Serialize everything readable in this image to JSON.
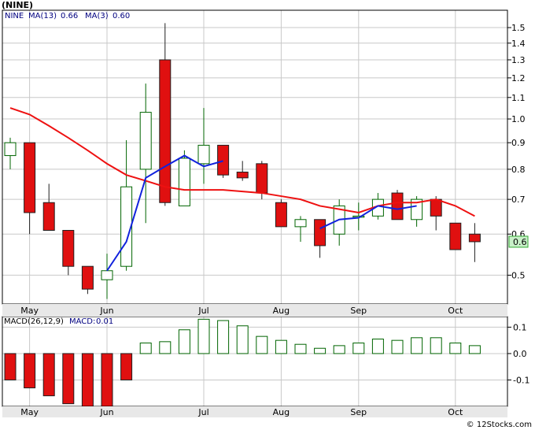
{
  "header": {
    "title": "(NINE)",
    "ma_legend": [
      {
        "label": "MA(13)",
        "value": "0.66",
        "color": "#000080"
      },
      {
        "label": "MA(3)",
        "value": "0.60",
        "color": "#000080"
      }
    ],
    "macd_legend": [
      {
        "label": "MACD(26,12,9)",
        "color": "#000000"
      },
      {
        "label": "MACD:",
        "value": "0.01",
        "color": "#000080"
      }
    ]
  },
  "colors": {
    "up_candle": "#ffffff",
    "up_outline": "#006400",
    "down_candle": "#e01010",
    "ma_long": "#ee1111",
    "ma_short": "#1122dd",
    "price_box": "#c8f0c8",
    "grid": "#c8c8c8"
  },
  "footer": {
    "copyright": "© 12Stocks.com"
  },
  "chart_data": [
    {
      "type": "candlestick",
      "scale": "log",
      "y_ticks": [
        "1.5",
        "1.4",
        "1.3",
        "1.2",
        "1.1",
        "1.0",
        "0.9",
        "0.8",
        "0.7",
        "0.6",
        "0.5"
      ],
      "y_tick_values": [
        1.5,
        1.4,
        1.3,
        1.2,
        1.1,
        1.0,
        0.9,
        0.8,
        0.7,
        0.6,
        0.5
      ],
      "ylim": [
        0.44,
        1.62
      ],
      "x_labels": [
        {
          "label": "May",
          "index": 1
        },
        {
          "label": "Jun",
          "index": 5
        },
        {
          "label": "Jul",
          "index": 10
        },
        {
          "label": "Aug",
          "index": 14
        },
        {
          "label": "Sep",
          "index": 18
        },
        {
          "label": "Oct",
          "index": 23
        }
      ],
      "last_price": "0.6",
      "candles": [
        {
          "o": 0.85,
          "h": 0.92,
          "l": 0.8,
          "c": 0.9
        },
        {
          "o": 0.9,
          "h": 0.9,
          "l": 0.6,
          "c": 0.66
        },
        {
          "o": 0.69,
          "h": 0.75,
          "l": 0.61,
          "c": 0.61
        },
        {
          "o": 0.61,
          "h": 0.61,
          "l": 0.5,
          "c": 0.52
        },
        {
          "o": 0.52,
          "h": 0.52,
          "l": 0.46,
          "c": 0.47
        },
        {
          "o": 0.49,
          "h": 0.55,
          "l": 0.45,
          "c": 0.51
        },
        {
          "o": 0.52,
          "h": 0.91,
          "l": 0.51,
          "c": 0.74
        },
        {
          "o": 0.8,
          "h": 1.17,
          "l": 0.63,
          "c": 1.03
        },
        {
          "o": 1.3,
          "h": 1.53,
          "l": 0.68,
          "c": 0.69
        },
        {
          "o": 0.68,
          "h": 0.87,
          "l": 0.68,
          "c": 0.84
        },
        {
          "o": 0.82,
          "h": 1.05,
          "l": 0.75,
          "c": 0.89
        },
        {
          "o": 0.89,
          "h": 0.89,
          "l": 0.77,
          "c": 0.78
        },
        {
          "o": 0.79,
          "h": 0.83,
          "l": 0.76,
          "c": 0.77
        },
        {
          "o": 0.82,
          "h": 0.83,
          "l": 0.7,
          "c": 0.72
        },
        {
          "o": 0.69,
          "h": 0.7,
          "l": 0.62,
          "c": 0.62
        },
        {
          "o": 0.62,
          "h": 0.65,
          "l": 0.58,
          "c": 0.64
        },
        {
          "o": 0.64,
          "h": 0.64,
          "l": 0.54,
          "c": 0.57
        },
        {
          "o": 0.6,
          "h": 0.7,
          "l": 0.57,
          "c": 0.68
        },
        {
          "o": 0.65,
          "h": 0.69,
          "l": 0.61,
          "c": 0.65
        },
        {
          "o": 0.65,
          "h": 0.72,
          "l": 0.64,
          "c": 0.7
        },
        {
          "o": 0.72,
          "h": 0.73,
          "l": 0.64,
          "c": 0.64
        },
        {
          "o": 0.64,
          "h": 0.71,
          "l": 0.62,
          "c": 0.7
        },
        {
          "o": 0.7,
          "h": 0.71,
          "l": 0.61,
          "c": 0.65
        },
        {
          "o": 0.63,
          "h": 0.63,
          "l": 0.56,
          "c": 0.56
        },
        {
          "o": 0.6,
          "h": 0.63,
          "l": 0.53,
          "c": 0.58
        }
      ],
      "ma_long": [
        1.05,
        1.02,
        0.97,
        0.92,
        0.87,
        0.82,
        0.78,
        0.76,
        0.74,
        0.73,
        0.73,
        0.73,
        0.725,
        0.72,
        0.71,
        0.7,
        0.68,
        0.67,
        0.66,
        0.68,
        0.69,
        0.69,
        0.7,
        0.68,
        0.65
      ],
      "ma_short": [
        null,
        null,
        null,
        null,
        null,
        0.51,
        0.58,
        0.77,
        0.81,
        0.85,
        0.81,
        0.83,
        null,
        null,
        null,
        null,
        0.615,
        0.64,
        0.645,
        0.68,
        0.67,
        0.68,
        null,
        null,
        null
      ],
      "ma_short_segments": [
        [
          5,
          6,
          7,
          8,
          9,
          10,
          11
        ],
        [
          16,
          17,
          18,
          19,
          20,
          21
        ]
      ],
      "ma_long_color": "red",
      "ma_short_color": "blue",
      "x_tail_labels": [
        {
          "label": "May",
          "index": 1
        },
        {
          "label": "Jun",
          "index": 5
        },
        {
          "label": "Jul",
          "index": 10
        },
        {
          "label": "Aug",
          "index": 14
        },
        {
          "label": "Sep",
          "index": 18
        },
        {
          "label": "Oct",
          "index": 23
        }
      ]
    },
    {
      "type": "bar",
      "y_ticks": [
        "0.1",
        "0.0",
        "-0.1"
      ],
      "y_tick_values": [
        0.1,
        0.0,
        -0.1
      ],
      "ylim": [
        -0.2,
        0.14
      ],
      "values": [
        -0.1,
        -0.13,
        -0.16,
        -0.19,
        -0.21,
        -0.2,
        -0.1,
        0.04,
        0.045,
        0.09,
        0.13,
        0.125,
        0.105,
        0.065,
        0.05,
        0.035,
        0.02,
        0.03,
        0.04,
        0.055,
        0.05,
        0.06,
        0.06,
        0.04,
        0.03
      ]
    }
  ]
}
